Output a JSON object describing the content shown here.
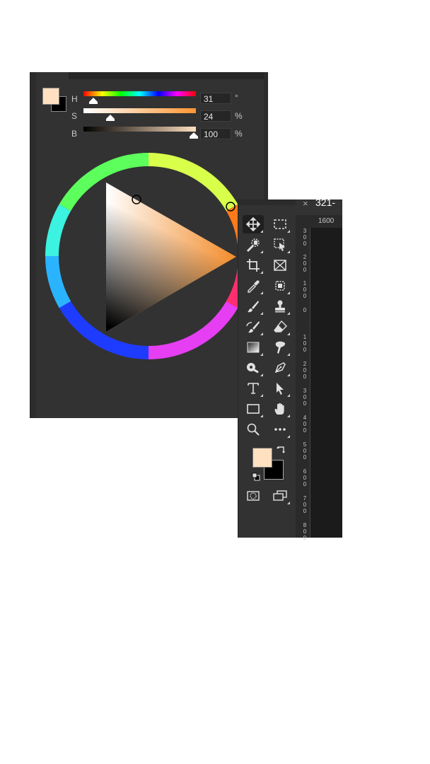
{
  "color_panel": {
    "hue": {
      "label": "H",
      "value": "31",
      "unit": "°"
    },
    "saturation": {
      "label": "S",
      "value": "24",
      "unit": "%"
    },
    "brightness": {
      "label": "B",
      "value": "100",
      "unit": "%"
    },
    "foreground_color": "#ffe0c0",
    "background_color": "#000000"
  },
  "tools": [
    "move-tool",
    "rectangular-marquee-tool",
    "quick-selection-tool",
    "object-selection-tool",
    "crop-tool",
    "frame-tool",
    "eyedropper-tool",
    "spot-healing-brush-tool",
    "brush-tool",
    "clone-stamp-tool",
    "history-brush-tool",
    "eraser-tool",
    "gradient-tool",
    "smudge-tool",
    "dodge-tool",
    "pen-tool",
    "type-tool",
    "path-selection-tool",
    "rectangle-tool",
    "hand-tool",
    "zoom-tool",
    "edit-toolbar"
  ],
  "document": {
    "tab_title": "321-",
    "close_glyph": "×",
    "ruler_h_label": "1600",
    "ruler_v_labels": [
      "300",
      "200",
      "100",
      "0",
      "100",
      "200",
      "300",
      "400",
      "500",
      "600",
      "700",
      "800"
    ]
  }
}
